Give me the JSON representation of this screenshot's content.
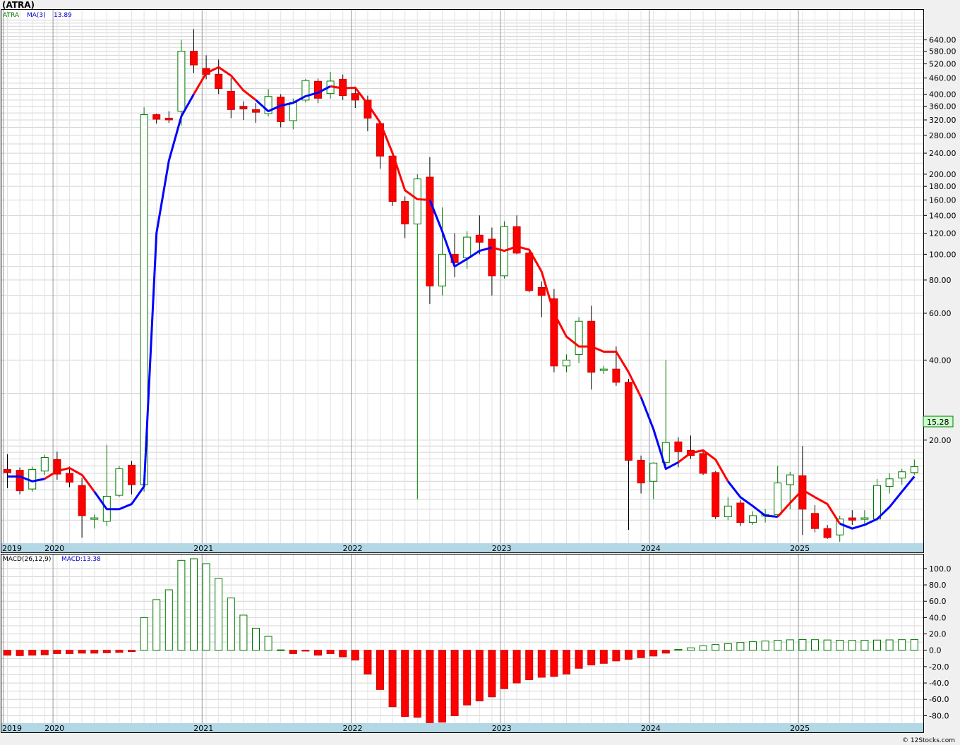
{
  "header": {
    "title": "(ATRA)"
  },
  "copyright": "© 12Stocks.com",
  "chart_data": [
    {
      "type": "candlestick",
      "legend": {
        "ticker": "ATRA",
        "ma_label": "MA(3)",
        "ma_value": "13.89"
      },
      "last_price_label": "15.28",
      "y_scale": "log",
      "ylim": [
        8.6,
        800
      ],
      "y_ticks": [
        {
          "v": 640,
          "label": "640.00"
        },
        {
          "v": 580,
          "label": "580.00"
        },
        {
          "v": 520,
          "label": "520.00"
        },
        {
          "v": 460,
          "label": "460.00"
        },
        {
          "v": 400,
          "label": "400.00"
        },
        {
          "v": 360,
          "label": "360.00"
        },
        {
          "v": 320,
          "label": "320.00"
        },
        {
          "v": 280,
          "label": "280.00"
        },
        {
          "v": 240,
          "label": "240.00"
        },
        {
          "v": 200,
          "label": "200.00"
        },
        {
          "v": 180,
          "label": "180.00"
        },
        {
          "v": 160,
          "label": "160.00"
        },
        {
          "v": 140,
          "label": "140.00"
        },
        {
          "v": 120,
          "label": "120.00"
        },
        {
          "v": 100,
          "label": "100.00"
        },
        {
          "v": 80,
          "label": "80.00"
        },
        {
          "v": 60,
          "label": "60.00"
        },
        {
          "v": 40,
          "label": "40.00"
        },
        {
          "v": 20,
          "label": "20.00"
        }
      ],
      "x_years": [
        "2019",
        "2020",
        "2021",
        "2022",
        "2023",
        "2024",
        "2025"
      ],
      "year_start_index": [
        0,
        4,
        16,
        28,
        40,
        52,
        64
      ],
      "candles": [
        {
          "o": 15.5,
          "h": 17.7,
          "l": 13.2,
          "c": 15.1
        },
        {
          "o": 15.4,
          "h": 15.8,
          "l": 12.5,
          "c": 12.9
        },
        {
          "o": 13.1,
          "h": 15.9,
          "l": 12.8,
          "c": 15.5
        },
        {
          "o": 15.3,
          "h": 17.6,
          "l": 14.8,
          "c": 17.2
        },
        {
          "o": 16.9,
          "h": 18.1,
          "l": 14.2,
          "c": 14.9
        },
        {
          "o": 15.0,
          "h": 15.9,
          "l": 13.3,
          "c": 13.9
        },
        {
          "o": 13.5,
          "h": 14.4,
          "l": 8.6,
          "c": 10.4
        },
        {
          "o": 10.1,
          "h": 10.5,
          "l": 9.3,
          "c": 10.2
        },
        {
          "o": 9.9,
          "h": 19.2,
          "l": 9.5,
          "c": 12.3
        },
        {
          "o": 12.4,
          "h": 16.0,
          "l": 12.2,
          "c": 15.6
        },
        {
          "o": 16.1,
          "h": 16.7,
          "l": 12.5,
          "c": 13.6
        },
        {
          "o": 13.6,
          "h": 357,
          "l": 12.8,
          "c": 335
        },
        {
          "o": 335,
          "h": 338,
          "l": 310,
          "c": 322
        },
        {
          "o": 325,
          "h": 345,
          "l": 312,
          "c": 320
        },
        {
          "o": 345,
          "h": 640,
          "l": 305,
          "c": 580
        },
        {
          "o": 580,
          "h": 702,
          "l": 480,
          "c": 515
        },
        {
          "o": 500,
          "h": 560,
          "l": 455,
          "c": 475
        },
        {
          "o": 475,
          "h": 540,
          "l": 400,
          "c": 420
        },
        {
          "o": 410,
          "h": 460,
          "l": 325,
          "c": 350
        },
        {
          "o": 360,
          "h": 376,
          "l": 320,
          "c": 352
        },
        {
          "o": 350,
          "h": 370,
          "l": 312,
          "c": 342
        },
        {
          "o": 338,
          "h": 418,
          "l": 330,
          "c": 392
        },
        {
          "o": 390,
          "h": 400,
          "l": 300,
          "c": 315
        },
        {
          "o": 318,
          "h": 385,
          "l": 295,
          "c": 372
        },
        {
          "o": 380,
          "h": 457,
          "l": 372,
          "c": 450
        },
        {
          "o": 447,
          "h": 458,
          "l": 370,
          "c": 386
        },
        {
          "o": 402,
          "h": 485,
          "l": 385,
          "c": 448
        },
        {
          "o": 455,
          "h": 474,
          "l": 380,
          "c": 395
        },
        {
          "o": 402,
          "h": 420,
          "l": 355,
          "c": 380
        },
        {
          "o": 380,
          "h": 395,
          "l": 290,
          "c": 325
        },
        {
          "o": 310,
          "h": 316,
          "l": 210,
          "c": 234
        },
        {
          "o": 234,
          "h": 237,
          "l": 152,
          "c": 158
        },
        {
          "o": 158,
          "h": 165,
          "l": 115,
          "c": 130
        },
        {
          "o": 130,
          "h": 200,
          "l": 12.0,
          "c": 192
        },
        {
          "o": 195,
          "h": 232,
          "l": 65,
          "c": 76
        },
        {
          "o": 76,
          "h": 150,
          "l": 70,
          "c": 100
        },
        {
          "o": 100,
          "h": 120,
          "l": 82,
          "c": 93
        },
        {
          "o": 97,
          "h": 122,
          "l": 88,
          "c": 116
        },
        {
          "o": 118,
          "h": 140,
          "l": 100,
          "c": 111
        },
        {
          "o": 114,
          "h": 126,
          "l": 70,
          "c": 83
        },
        {
          "o": 83,
          "h": 133,
          "l": 81,
          "c": 127
        },
        {
          "o": 127,
          "h": 140,
          "l": 100,
          "c": 101
        },
        {
          "o": 101,
          "h": 103,
          "l": 72,
          "c": 73
        },
        {
          "o": 75,
          "h": 79,
          "l": 58,
          "c": 70
        },
        {
          "o": 68,
          "h": 74,
          "l": 36,
          "c": 38
        },
        {
          "o": 38,
          "h": 42,
          "l": 36,
          "c": 40
        },
        {
          "o": 42,
          "h": 58,
          "l": 39,
          "c": 56
        },
        {
          "o": 56,
          "h": 64,
          "l": 31,
          "c": 36
        },
        {
          "o": 37,
          "h": 38,
          "l": 35.5,
          "c": 37
        },
        {
          "o": 37,
          "h": 45,
          "l": 32,
          "c": 33
        },
        {
          "o": 33,
          "h": 34,
          "l": 9.2,
          "c": 16.8
        },
        {
          "o": 16.8,
          "h": 17.5,
          "l": 12.6,
          "c": 13.8
        },
        {
          "o": 14.0,
          "h": 16.5,
          "l": 12.0,
          "c": 16.4
        },
        {
          "o": 16.5,
          "h": 40.0,
          "l": 15.8,
          "c": 19.6
        },
        {
          "o": 19.7,
          "h": 20.5,
          "l": 15.8,
          "c": 18.1
        },
        {
          "o": 18.3,
          "h": 20.8,
          "l": 17.0,
          "c": 17.5
        },
        {
          "o": 17.8,
          "h": 18.2,
          "l": 14.8,
          "c": 15.0
        },
        {
          "o": 15.1,
          "h": 15.3,
          "l": 10.1,
          "c": 10.3
        },
        {
          "o": 10.3,
          "h": 12.2,
          "l": 10.0,
          "c": 11.3
        },
        {
          "o": 11.6,
          "h": 11.9,
          "l": 9.5,
          "c": 9.8
        },
        {
          "o": 9.8,
          "h": 10.8,
          "l": 9.6,
          "c": 10.4
        },
        {
          "o": 10.4,
          "h": 11.0,
          "l": 9.8,
          "c": 10.5
        },
        {
          "o": 10.5,
          "h": 16.0,
          "l": 10.3,
          "c": 13.8
        },
        {
          "o": 13.6,
          "h": 15.2,
          "l": 11.0,
          "c": 14.8
        },
        {
          "o": 14.7,
          "h": 19.0,
          "l": 8.8,
          "c": 11.0
        },
        {
          "o": 10.6,
          "h": 11.4,
          "l": 9.0,
          "c": 9.3
        },
        {
          "o": 9.3,
          "h": 9.6,
          "l": 8.5,
          "c": 8.6
        },
        {
          "o": 8.8,
          "h": 10.4,
          "l": 8.3,
          "c": 10.1
        },
        {
          "o": 10.2,
          "h": 10.9,
          "l": 9.6,
          "c": 10.0
        },
        {
          "o": 10.1,
          "h": 10.9,
          "l": 9.7,
          "c": 10.2
        },
        {
          "o": 10.1,
          "h": 14.3,
          "l": 9.9,
          "c": 13.5
        },
        {
          "o": 13.4,
          "h": 15.0,
          "l": 12.6,
          "c": 14.3
        },
        {
          "o": 14.4,
          "h": 15.6,
          "l": 13.6,
          "c": 15.2
        },
        {
          "o": 15.1,
          "h": 16.9,
          "l": 14.8,
          "c": 15.9
        }
      ],
      "ma": [
        14.6,
        14.6,
        14.0,
        14.3,
        15.3,
        15.7,
        14.8,
        12.8,
        11.0,
        11.0,
        11.5,
        13.4,
        120,
        225,
        330,
        400,
        480,
        505,
        470,
        413,
        380,
        345,
        362,
        371,
        393,
        405,
        428,
        421,
        423,
        367,
        313,
        240,
        174,
        161,
        160,
        122,
        90,
        96,
        103,
        106,
        103,
        107,
        104,
        86,
        60,
        49,
        45,
        45,
        43,
        43,
        36,
        29,
        22,
        15.6,
        16.5,
        17.9,
        18.3,
        16.9,
        14.0,
        12.2,
        11.3,
        10.4,
        10.3,
        11.6,
        13.0,
        12.2,
        11.5,
        9.7,
        9.3,
        9.6,
        10.1,
        11.2,
        12.8,
        14.6
      ],
      "ma_red_segments": [
        [
          0,
          0
        ],
        [
          3,
          7
        ],
        [
          15,
          20
        ],
        [
          26,
          34
        ],
        [
          39,
          51
        ],
        [
          54,
          58
        ],
        [
          62,
          67
        ]
      ],
      "ma_blue_segments": [
        [
          0,
          3
        ],
        [
          7,
          15
        ],
        [
          20,
          26
        ],
        [
          34,
          39
        ],
        [
          51,
          54
        ],
        [
          58,
          62
        ],
        [
          67,
          73
        ]
      ]
    },
    {
      "type": "histogram",
      "legend": {
        "label": "MACD(26,12,9)",
        "value_label": "MACD:13.38"
      },
      "ylim": [
        -90,
        112
      ],
      "y_ticks": [
        {
          "v": 100,
          "label": "100.0"
        },
        {
          "v": 80,
          "label": "80.0"
        },
        {
          "v": 60,
          "label": "60.0"
        },
        {
          "v": 40,
          "label": "40.0"
        },
        {
          "v": 20,
          "label": "20.0"
        },
        {
          "v": 0,
          "label": "0.0"
        },
        {
          "v": -20,
          "label": "-20.0"
        },
        {
          "v": -40,
          "label": "-40.0"
        },
        {
          "v": -60,
          "label": "-60.0"
        },
        {
          "v": -80,
          "label": "-80.0"
        }
      ],
      "x_years": [
        "2019",
        "2020",
        "2021",
        "2022",
        "2023",
        "2024",
        "2025"
      ],
      "values": [
        -6,
        -6.5,
        -6,
        -5.5,
        -4,
        -4,
        -3.5,
        -3.5,
        -3,
        -2.5,
        -1.5,
        40,
        62,
        74,
        110,
        112,
        106,
        88,
        64,
        43,
        27,
        17,
        0.5,
        -4,
        -1,
        -6,
        -4,
        -8,
        -12,
        -29,
        -48,
        -69,
        -81,
        -82,
        -90,
        -88,
        -80,
        -67,
        -62,
        -57,
        -47,
        -40,
        -36,
        -33,
        -32,
        -29,
        -22,
        -18,
        -16,
        -13,
        -11,
        -9,
        -7,
        -3.5,
        1,
        3,
        5.5,
        7,
        8,
        9.5,
        10.5,
        11.3,
        12.2,
        12.8,
        13.2,
        13.0,
        12.6,
        12.3,
        12.1,
        12.2,
        12.5,
        12.7,
        13.0,
        13.1
      ]
    }
  ]
}
